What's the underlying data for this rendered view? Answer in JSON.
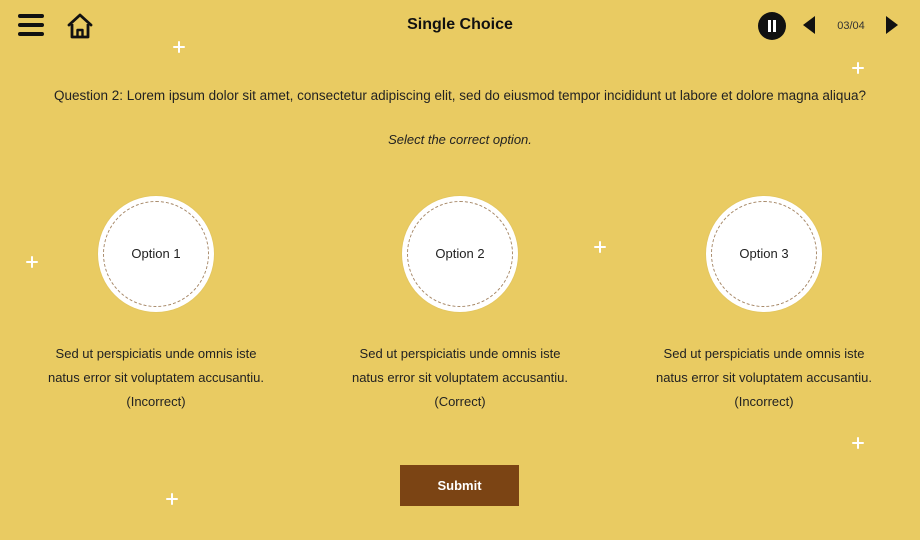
{
  "header": {
    "title": "Single Choice",
    "counter": "03/04",
    "icons": [
      "menu-icon",
      "home-icon",
      "pause-icon",
      "prev-icon",
      "next-icon"
    ]
  },
  "question": {
    "text": "Question 2: Lorem ipsum dolor sit amet, consectetur adipiscing elit, sed do eiusmod tempor incididunt ut labore et dolore magna aliqua?",
    "instruction": "Select the correct option."
  },
  "options": [
    {
      "label": "Option 1",
      "feedback_line1": "Sed ut perspiciatis unde omnis iste",
      "feedback_line2": "natus error sit voluptatem accusantiu.",
      "result": "(Incorrect)"
    },
    {
      "label": "Option 2",
      "feedback_line1": "Sed ut perspiciatis unde omnis iste",
      "feedback_line2": "natus error sit voluptatem accusantiu.",
      "result": "(Correct)"
    },
    {
      "label": "Option 3",
      "feedback_line1": "Sed ut perspiciatis unde omnis iste",
      "feedback_line2": "natus error sit voluptatem accusantiu.",
      "result": "(Incorrect)"
    }
  ],
  "submit_label": "Submit",
  "colors": {
    "background": "#E9CB62",
    "submit": "#7B4414",
    "circle": "#FFFFFF",
    "sparkle": "#FFFFFF"
  }
}
